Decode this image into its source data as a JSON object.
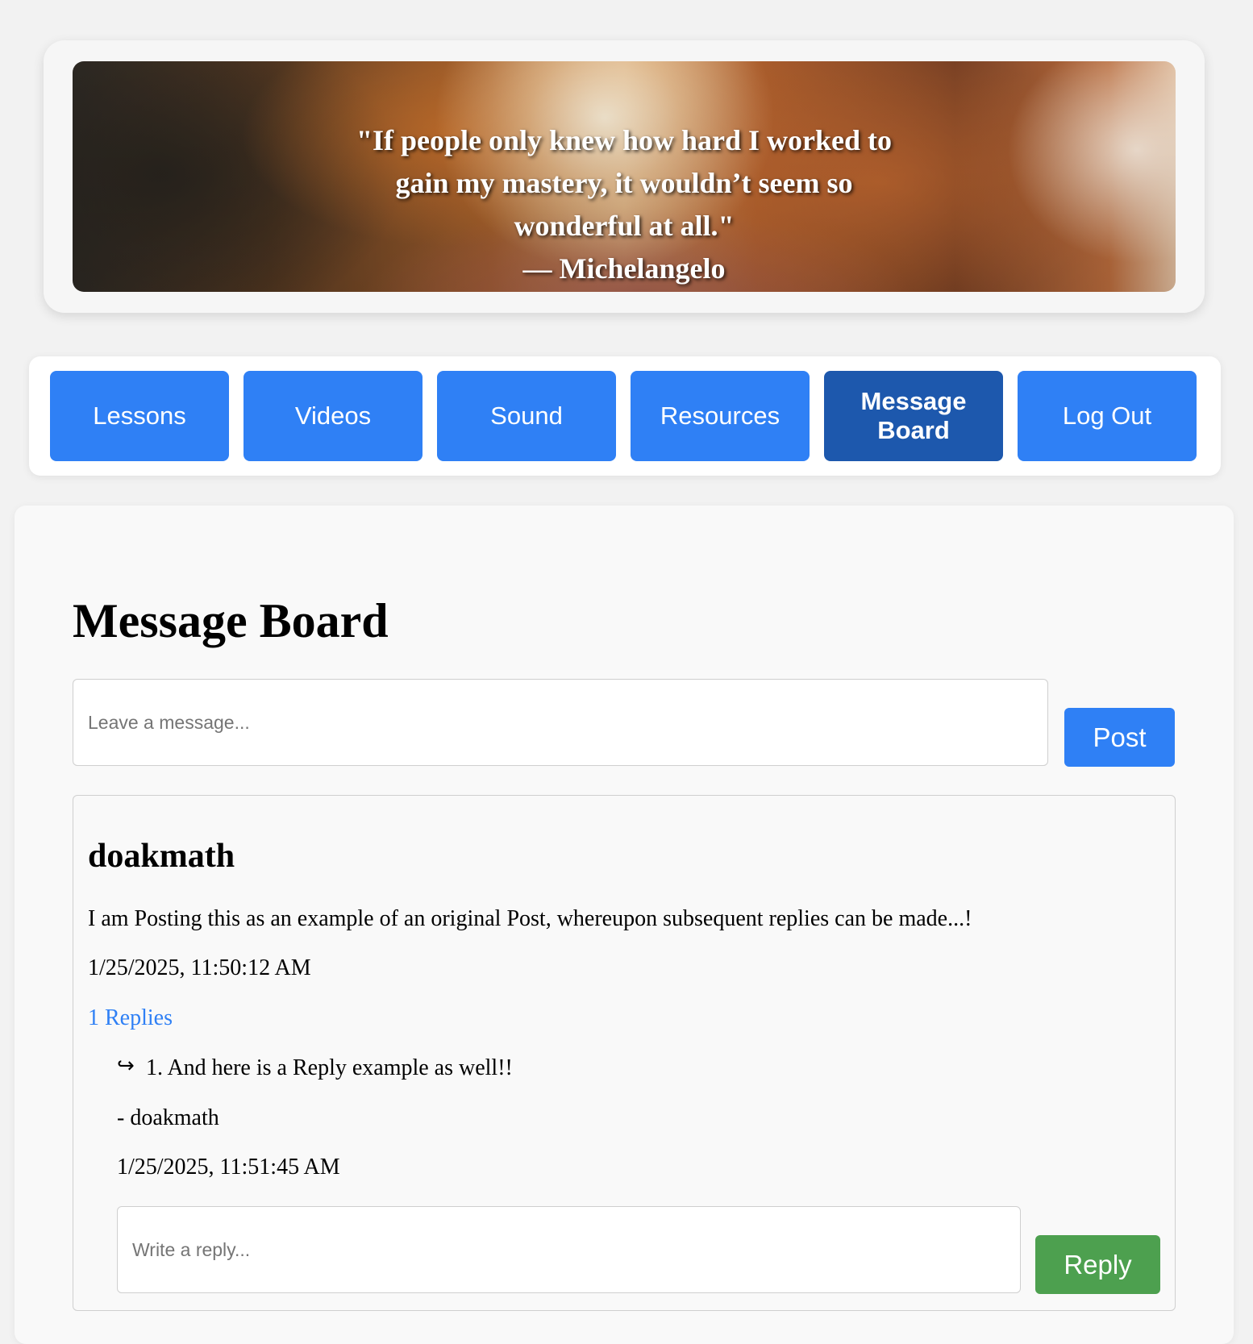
{
  "banner": {
    "quote": "\"If people only knew how hard I worked to gain my mastery, it wouldn’t seem so wonderful at all.\"",
    "author": "— Michelangelo"
  },
  "nav": {
    "items": [
      {
        "label": "Lessons",
        "active": false
      },
      {
        "label": "Videos",
        "active": false
      },
      {
        "label": "Sound",
        "active": false
      },
      {
        "label": "Resources",
        "active": false
      },
      {
        "label": "Message Board",
        "active": true
      },
      {
        "label": "Log Out",
        "active": false
      }
    ],
    "colors": {
      "button": "#2f80f5",
      "active": "#1d58ad"
    }
  },
  "main": {
    "title": "Message Board",
    "message_placeholder": "Leave a message...",
    "post_label": "Post"
  },
  "post": {
    "author": "doakmath",
    "body": "I am Posting this as an example of an original Post, whereupon subsequent replies can be made...!",
    "timestamp": "1/25/2025, 11:50:12 AM",
    "replies_label": "1 Replies",
    "replies": [
      {
        "icon": "reply-arrow-icon",
        "arrow": "↪",
        "text": "1. And here is a Reply example as well!!",
        "author": "- doakmath",
        "timestamp": "1/25/2025, 11:51:45 AM"
      }
    ],
    "reply_placeholder": "Write a reply...",
    "reply_label": "Reply",
    "colors": {
      "link": "#2f80f5",
      "reply_button": "#4da04f"
    }
  }
}
